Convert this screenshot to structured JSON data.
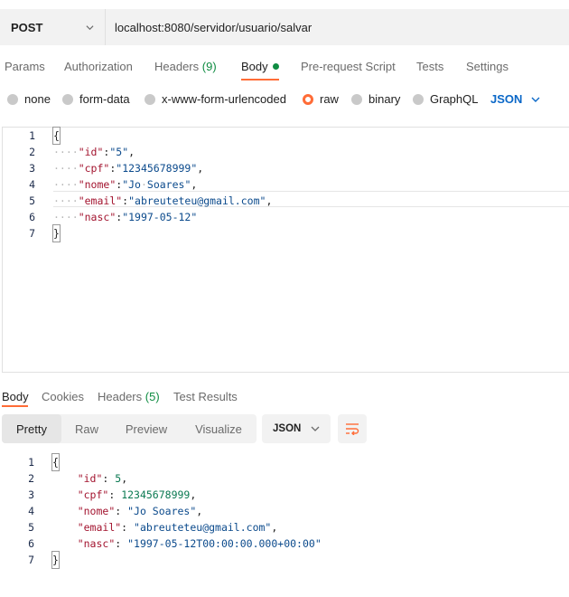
{
  "request": {
    "method": "POST",
    "url": "localhost:8080/servidor/usuario/salvar"
  },
  "request_tabs": [
    {
      "label": "Params"
    },
    {
      "label": "Authorization"
    },
    {
      "label": "Headers",
      "count": "(9)"
    },
    {
      "label": "Body"
    },
    {
      "label": "Pre-request Script"
    },
    {
      "label": "Tests"
    },
    {
      "label": "Settings"
    }
  ],
  "body_options": [
    "none",
    "form-data",
    "x-www-form-urlencoded",
    "raw",
    "binary",
    "GraphQL"
  ],
  "body_selected": "raw",
  "body_language": "JSON",
  "request_body": {
    "line_numbers": [
      "1",
      "2",
      "3",
      "4",
      "5",
      "6",
      "7"
    ],
    "open_brace": "{",
    "close_brace": "}",
    "fields": [
      {
        "key": "\"id\"",
        "value": "\"5\"",
        "sep": ","
      },
      {
        "key": "\"cpf\"",
        "value": "\"12345678999\"",
        "sep": ","
      },
      {
        "key": "\"nome\"",
        "value": "\"Jo Soares\"",
        "sep": ","
      },
      {
        "key": "\"email\"",
        "value": "\"abreuteteu@gmail.com\"",
        "sep": ","
      },
      {
        "key": "\"nasc\"",
        "value": "\"1997-05-12\"",
        "sep": ""
      }
    ]
  },
  "response_tabs": [
    {
      "label": "Body"
    },
    {
      "label": "Cookies"
    },
    {
      "label": "Headers",
      "count": "(5)"
    },
    {
      "label": "Test Results"
    }
  ],
  "response_view_modes": [
    "Pretty",
    "Raw",
    "Preview",
    "Visualize"
  ],
  "response_format": "JSON",
  "response_body": {
    "line_numbers": [
      "1",
      "2",
      "3",
      "4",
      "5",
      "6",
      "7"
    ],
    "open_brace": "{",
    "close_brace": "}",
    "fields": [
      {
        "key": "\"id\"",
        "value": "5",
        "type": "number",
        "sep": ","
      },
      {
        "key": "\"cpf\"",
        "value": "12345678999",
        "type": "number",
        "sep": ","
      },
      {
        "key": "\"nome\"",
        "value": "\"Jo Soares\"",
        "type": "string",
        "sep": ","
      },
      {
        "key": "\"email\"",
        "value": "\"abreuteteu@gmail.com\"",
        "type": "string",
        "sep": ","
      },
      {
        "key": "\"nasc\"",
        "value": "\"1997-05-12T00:00:00.000+00:00\"",
        "type": "string",
        "sep": ""
      }
    ]
  },
  "colors": {
    "accent": "#ff6c37",
    "count_green": "#0f8c42",
    "link_blue": "#0b68c8"
  }
}
